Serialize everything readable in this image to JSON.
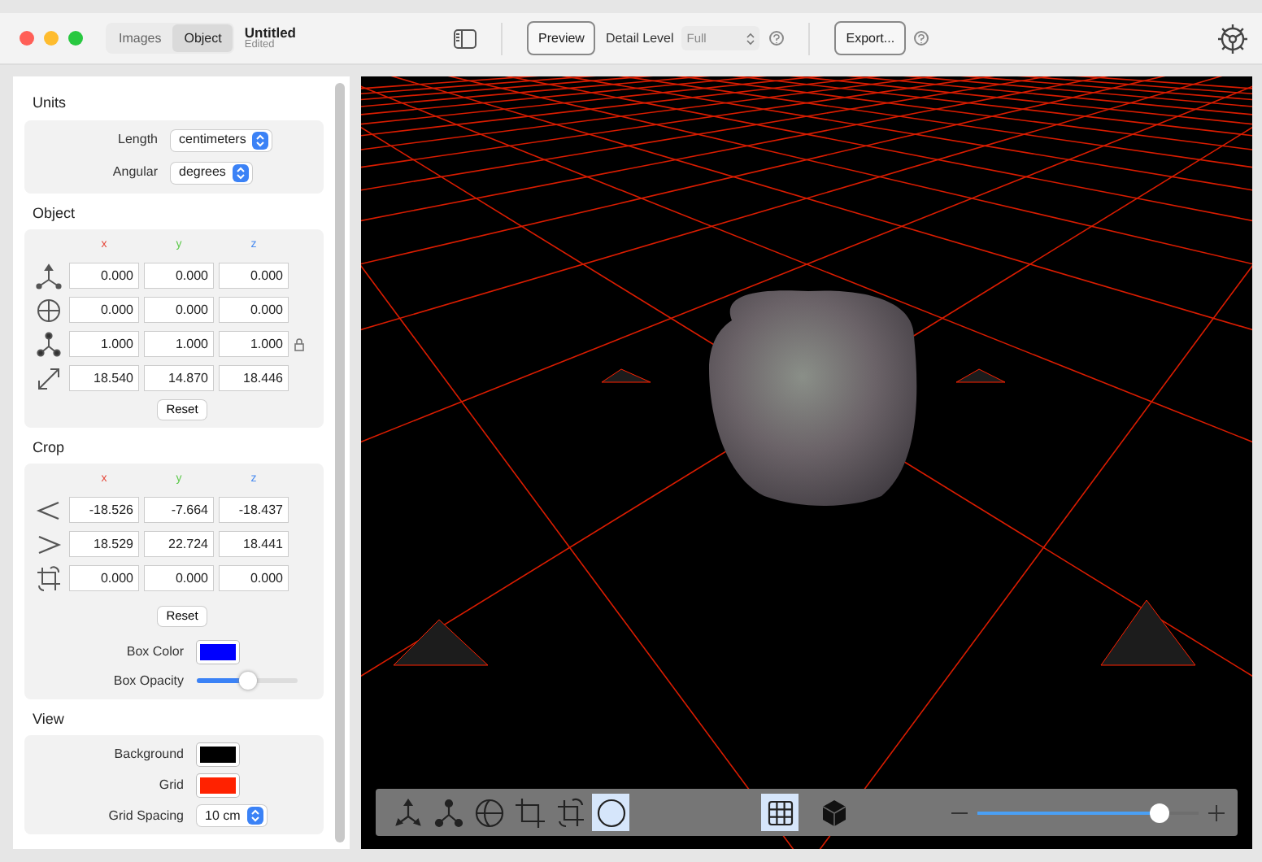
{
  "toolbar": {
    "mode_tabs": [
      {
        "label": "Images",
        "selected": false
      },
      {
        "label": "Object",
        "selected": true
      }
    ],
    "document": {
      "title": "Untitled",
      "subtitle": "Edited"
    },
    "preview_button": "Preview",
    "detail_level": {
      "label": "Detail Level",
      "value": "Full"
    },
    "export_button": "Export..."
  },
  "units": {
    "title": "Units",
    "rows": [
      {
        "label": "Length",
        "value": "centimeters"
      },
      {
        "label": "Angular",
        "value": "degrees"
      }
    ]
  },
  "object": {
    "title": "Object",
    "axes": [
      {
        "label": "x",
        "color": "#e5483b"
      },
      {
        "label": "y",
        "color": "#5cc94a"
      },
      {
        "label": "z",
        "color": "#4a8cf0"
      }
    ],
    "rows": [
      {
        "kind": "position",
        "values": [
          "0.000",
          "0.000",
          "0.000"
        ]
      },
      {
        "kind": "rotation",
        "values": [
          "0.000",
          "0.000",
          "0.000"
        ]
      },
      {
        "kind": "scale",
        "values": [
          "1.000",
          "1.000",
          "1.000"
        ]
      },
      {
        "kind": "size",
        "values": [
          "18.540",
          "14.870",
          "18.446"
        ]
      }
    ],
    "reset": "Reset"
  },
  "crop": {
    "title": "Crop",
    "axes": [
      {
        "label": "x",
        "color": "#e5483b"
      },
      {
        "label": "y",
        "color": "#5cc94a"
      },
      {
        "label": "z",
        "color": "#4a8cf0"
      }
    ],
    "rows": [
      {
        "kind": "min",
        "values": [
          "-18.526",
          "-7.664",
          "-18.437"
        ]
      },
      {
        "kind": "max",
        "values": [
          "18.529",
          "22.724",
          "18.441"
        ]
      },
      {
        "kind": "offset",
        "values": [
          "0.000",
          "0.000",
          "0.000"
        ]
      }
    ],
    "reset": "Reset",
    "box_color": {
      "label": "Box Color",
      "color": "#0000ff"
    },
    "box_opacity": {
      "label": "Box Opacity",
      "level": 0.5
    }
  },
  "view": {
    "title": "View",
    "background": {
      "label": "Background",
      "color": "#000000"
    },
    "grid": {
      "label": "Grid",
      "color": "#ff2200"
    },
    "grid_spacing": {
      "label": "Grid Spacing",
      "value": "10 cm"
    }
  },
  "viewport_toolbar": {
    "tools": [
      {
        "kind": "move",
        "selected": false
      },
      {
        "kind": "scale",
        "selected": false
      },
      {
        "kind": "rotate",
        "selected": false
      },
      {
        "kind": "crop",
        "selected": false
      },
      {
        "kind": "crop-rotate",
        "selected": false
      },
      {
        "kind": "circle",
        "selected": true
      }
    ],
    "view_toggles": [
      {
        "kind": "grid",
        "selected": true
      },
      {
        "kind": "cube",
        "selected": false
      }
    ],
    "zoom": {
      "level": 0.82
    }
  }
}
